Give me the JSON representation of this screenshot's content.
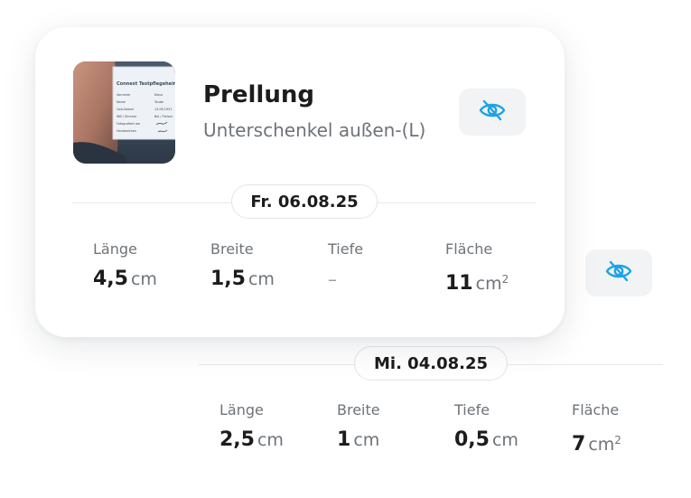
{
  "wound": {
    "title": "Prellung",
    "location": "Unterschenkel außen-(L)",
    "photo_icon": "wound-photo"
  },
  "colors": {
    "accent": "#1fa3e6",
    "pill_border": "#e3e5e8",
    "button_bg": "#f1f3f5"
  },
  "toggle_icon": "eye-slash-icon",
  "measurements": [
    {
      "date": "Fr. 06.08.25",
      "laenge": {
        "label": "Länge",
        "value": "4,5",
        "unit": "cm"
      },
      "breite": {
        "label": "Breite",
        "value": "1,5",
        "unit": "cm"
      },
      "tiefe": {
        "label": "Tiefe",
        "value": "–",
        "unit": ""
      },
      "flaeche": {
        "label": "Fläche",
        "value": "11",
        "unit": "cm",
        "unit_sup": "2"
      }
    },
    {
      "date": "Mi. 04.08.25",
      "laenge": {
        "label": "Länge",
        "value": "2,5",
        "unit": "cm"
      },
      "breite": {
        "label": "Breite",
        "value": "1",
        "unit": "cm"
      },
      "tiefe": {
        "label": "Tiefe",
        "value": "0,5",
        "unit": "cm"
      },
      "flaeche": {
        "label": "Fläche",
        "value": "7",
        "unit": "cm",
        "unit_sup": "2"
      }
    }
  ]
}
